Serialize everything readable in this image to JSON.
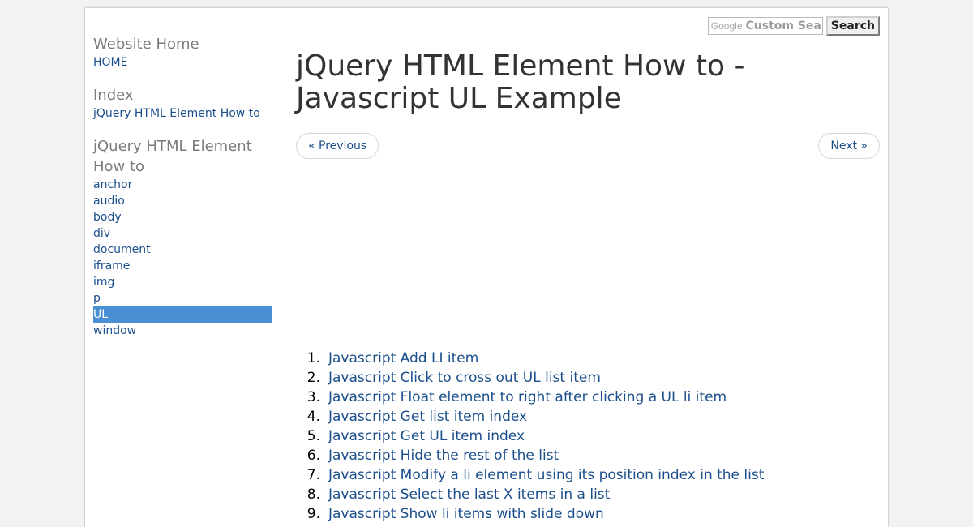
{
  "search": {
    "logo_text": "Google",
    "placeholder": "Custom Search",
    "button_label": "Search"
  },
  "sidebar": {
    "groups": [
      {
        "heading": "Website Home",
        "links": [
          "HOME"
        ]
      },
      {
        "heading": "Index",
        "links": [
          "jQuery HTML Element How to"
        ]
      },
      {
        "heading": "jQuery HTML Element How to",
        "links": [
          "anchor",
          "audio",
          "body",
          "div",
          "document",
          "iframe",
          "img",
          "p",
          "UL",
          "window"
        ],
        "active": "UL"
      }
    ]
  },
  "main": {
    "title": "jQuery HTML Element How to - Javascript UL Example",
    "prev_label": "« Previous",
    "next_label": "Next »",
    "list": [
      "Javascript Add LI item",
      "Javascript Click to cross out UL list item",
      "Javascript Float element to right after clicking a UL li item",
      "Javascript Get list item index",
      "Javascript Get UL item index",
      "Javascript Hide the rest of the list",
      "Javascript Modify a li element using its position index in the list",
      "Javascript Select the last X items in a list",
      "Javascript Show li items with slide down"
    ]
  }
}
